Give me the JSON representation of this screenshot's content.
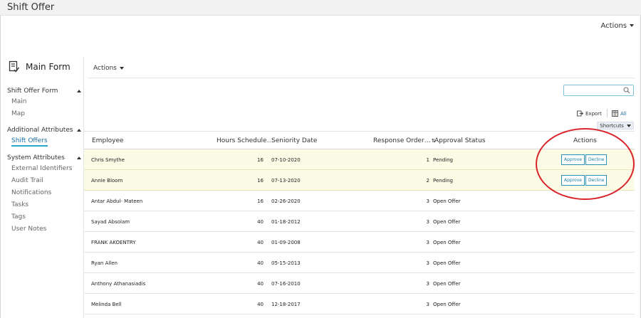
{
  "window": {
    "title": "Shift Offer"
  },
  "top_actions": {
    "label": "Actions"
  },
  "sidebar": {
    "title": "Main Form",
    "sections": [
      {
        "label": "Shift Offer Form",
        "items": [
          "Main",
          "Map"
        ]
      },
      {
        "label": "Additional Attributes",
        "items": [
          "Shift Offers"
        ]
      },
      {
        "label": "System Attributes",
        "items": [
          "External Identifiers",
          "Audit Trail",
          "Notifications",
          "Tasks",
          "Tags",
          "User Notes"
        ]
      }
    ],
    "active_item": "Shift Offers"
  },
  "main": {
    "actions_label": "Actions",
    "search": {
      "placeholder": "",
      "value": ""
    },
    "toolbar": {
      "export_label": "Export",
      "all_label": "All",
      "shortcuts_label": "Shortcuts"
    },
    "table": {
      "columns": [
        "Employee",
        "Hours Schedule…",
        "Seniority Date",
        "Response Order…",
        "Approval Status",
        "Actions"
      ],
      "rows": [
        {
          "employee": "Chris Smythe",
          "hours": "16",
          "seniority": "07-10-2020",
          "order": "1",
          "status": "Pending",
          "highlighted": true,
          "approve": "Approve",
          "decline": "Decline"
        },
        {
          "employee": "Annie Bloom",
          "hours": "16",
          "seniority": "07-13-2020",
          "order": "2",
          "status": "Pending",
          "highlighted": true,
          "approve": "Approve",
          "decline": "Decline"
        },
        {
          "employee": "Antar Abdul- Mateen",
          "hours": "16",
          "seniority": "02-26-2020",
          "order": "3",
          "status": "Open Offer"
        },
        {
          "employee": "Sayad Absolam",
          "hours": "40",
          "seniority": "01-18-2012",
          "order": "3",
          "status": "Open Offer"
        },
        {
          "employee": "FRANK AKOENTRY",
          "hours": "40",
          "seniority": "01-09-2008",
          "order": "3",
          "status": "Open Offer"
        },
        {
          "employee": "Ryan Allen",
          "hours": "40",
          "seniority": "05-15-2013",
          "order": "3",
          "status": "Open Offer"
        },
        {
          "employee": "Anthony Athanasiadis",
          "hours": "40",
          "seniority": "07-16-2010",
          "order": "3",
          "status": "Open Offer"
        },
        {
          "employee": "Melinda Bell",
          "hours": "40",
          "seniority": "12-18-2017",
          "order": "3",
          "status": "Open Offer"
        }
      ]
    }
  },
  "colors": {
    "accent": "#2a90b8",
    "highlight_row": "#fbfbe6",
    "annotation_ring": "#d9232a",
    "title_bar": "#f2f2f2"
  },
  "icons": {
    "form": "form-check-icon",
    "search": "search-icon",
    "export": "export-icon",
    "grid": "grid-icon"
  }
}
